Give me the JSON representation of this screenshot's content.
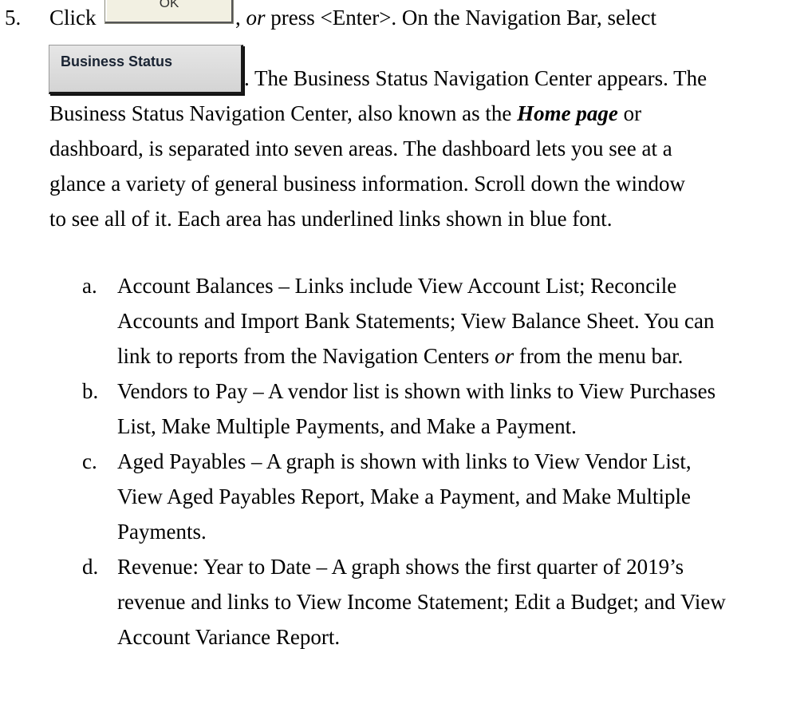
{
  "step": {
    "number": "5.",
    "ok_button_label": "OK",
    "business_status_button_label": "Business Status",
    "line1": {
      "before_button": "Click",
      "after_button_a": ", ",
      "or": "or",
      "after_button_b": " press <Enter>. On the Navigation Bar, select"
    },
    "line2_after_button": ". The Business Status Navigation Center appears. The",
    "line3": {
      "before": "Business Status Navigation Center, also known as the ",
      "emphasis": "Home page",
      "after": " or"
    },
    "line4": "dashboard, is separated into seven areas. The dashboard lets you see at a",
    "line5": "glance a variety of general business information. Scroll down the window",
    "line6": "to see all of it. Each area has underlined links shown in blue font."
  },
  "substeps": [
    {
      "letter": "a.",
      "lines": [
        "Account Balances – Links include View Account List; Reconcile",
        "Accounts and Import Bank Statements; View Balance Sheet. You can"
      ],
      "last_line": {
        "before": "link to reports from the Navigation Centers ",
        "emphasis": "or",
        "after": " from the menu bar."
      }
    },
    {
      "letter": "b.",
      "lines": [
        "Vendors to Pay – A vendor list is shown with links to View Purchases",
        "List, Make Multiple Payments, and Make a Payment."
      ]
    },
    {
      "letter": "c.",
      "lines": [
        "Aged Payables – A graph is shown with links to View Vendor List,",
        "View Aged Payables Report, Make a Payment, and Make Multiple",
        "Payments."
      ]
    },
    {
      "letter": "d.",
      "lines": [
        "Revenue: Year to Date – A graph shows the first quarter of 2019’s",
        "revenue and links to View Income Statement; Edit a Budget; and View",
        "Account Variance Report."
      ]
    }
  ]
}
